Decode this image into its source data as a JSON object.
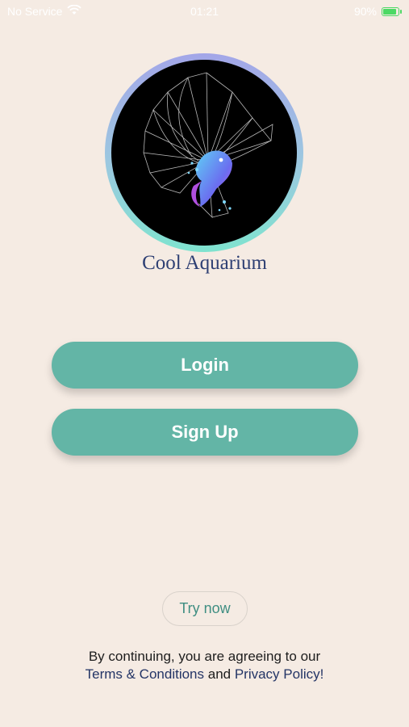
{
  "status_bar": {
    "carrier": "No Service",
    "time": "01:21",
    "battery_percent": "90%",
    "battery_level": 0.9,
    "wifi_icon": "wifi-icon",
    "battery_icon": "battery-charging-icon"
  },
  "logo": {
    "title": "Cool Aquarium",
    "icon": "betta-fish-logo"
  },
  "buttons": {
    "login": "Login",
    "signup": "Sign Up",
    "try_now": "Try now"
  },
  "legal": {
    "line1": "By continuing, you are agreeing to our",
    "terms": "Terms & Conditions",
    "and": " and ",
    "privacy": "Privacy Policy!"
  },
  "colors": {
    "background": "#f5ebe3",
    "accent": "#63b5a6",
    "title": "#2e3f73",
    "link": "#243566"
  }
}
